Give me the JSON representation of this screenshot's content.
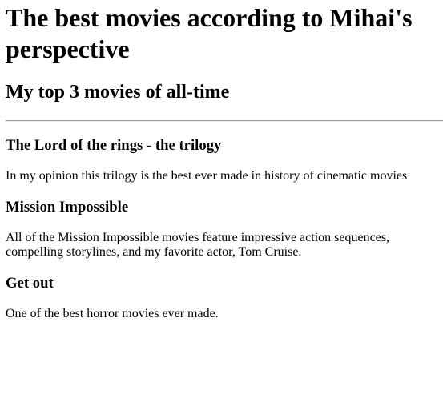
{
  "page": {
    "title": "The best movies according to Mihai's perspective",
    "subtitle": "My top 3 movies of all-time"
  },
  "movies": [
    {
      "title": "The Lord of the rings - the trilogy",
      "description": "In my opinion this trilogy is the best ever made in history of cinematic movies"
    },
    {
      "title": "Mission Impossible",
      "description": "All of the Mission Impossible movies feature impressive action sequences, compelling storylines, and my favorite actor, Tom Cruise."
    },
    {
      "title": "Get out",
      "description": "One of the best horror movies ever made."
    }
  ]
}
